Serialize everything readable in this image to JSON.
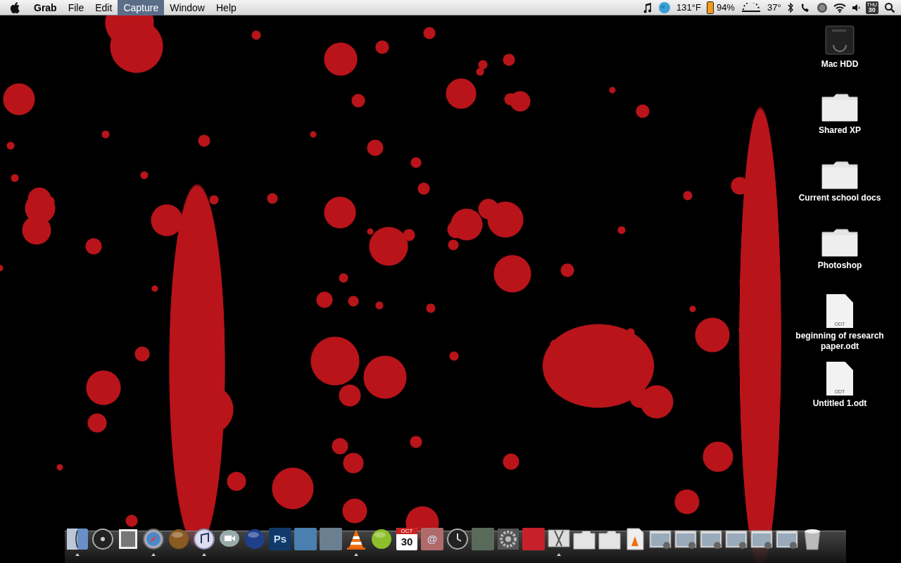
{
  "menu_bar": {
    "app_name": "Grab",
    "menus": [
      {
        "label": "File",
        "selected": false
      },
      {
        "label": "Edit",
        "selected": false
      },
      {
        "label": "Capture",
        "selected": true
      },
      {
        "label": "Window",
        "selected": false
      },
      {
        "label": "Help",
        "selected": false
      }
    ],
    "extras": [
      {
        "kind": "music"
      },
      {
        "kind": "globe"
      },
      {
        "kind": "text",
        "text": "131°F"
      },
      {
        "kind": "battery",
        "level": 0.94,
        "text": "94%"
      },
      {
        "kind": "weather"
      },
      {
        "kind": "text",
        "text": "37°"
      },
      {
        "kind": "bluetooth"
      },
      {
        "kind": "phone"
      },
      {
        "kind": "record"
      },
      {
        "kind": "wifi"
      },
      {
        "kind": "volume"
      },
      {
        "kind": "calendar",
        "day": "THU",
        "date": "30"
      },
      {
        "kind": "search"
      }
    ]
  },
  "desktop_icons": [
    {
      "kind": "drive",
      "label": "Mac HDD"
    },
    {
      "kind": "folder",
      "label": "Shared XP"
    },
    {
      "kind": "folder",
      "label": "Current school docs"
    },
    {
      "kind": "folder",
      "label": "Photoshop"
    },
    {
      "kind": "document",
      "label": "beginning of research paper.odt",
      "badge": "ODT"
    },
    {
      "kind": "document",
      "label": "Untitled 1.odt",
      "badge": "ODT"
    }
  ],
  "dock": [
    {
      "kind": "finder",
      "running": true
    },
    {
      "kind": "dashboard",
      "running": false
    },
    {
      "kind": "stamp",
      "running": false
    },
    {
      "kind": "compass",
      "running": true
    },
    {
      "kind": "orb",
      "color": "#8a5a20",
      "running": false
    },
    {
      "kind": "music",
      "running": true
    },
    {
      "kind": "video",
      "running": false
    },
    {
      "kind": "orb",
      "color": "#1e3f8a",
      "running": false
    },
    {
      "kind": "tile",
      "text": "Ps",
      "color": "#0f3a6a",
      "running": false
    },
    {
      "kind": "tile",
      "color": "#4a7fb0",
      "running": false
    },
    {
      "kind": "tile",
      "color": "#6a7f90",
      "running": false
    },
    {
      "kind": "cone",
      "running": true
    },
    {
      "kind": "orb",
      "color": "#8cbf2a",
      "running": false
    },
    {
      "kind": "calendar",
      "month": "OCT",
      "date": "30",
      "running": false
    },
    {
      "kind": "tile",
      "text": "@",
      "color": "#b06a6a",
      "running": false
    },
    {
      "kind": "clock",
      "running": false
    },
    {
      "kind": "tile",
      "color": "#5a6a5a",
      "running": false
    },
    {
      "kind": "gear",
      "running": false
    },
    {
      "kind": "tile",
      "color": "#c8202a",
      "running": false
    },
    {
      "kind": "scissors",
      "running": true
    },
    {
      "kind": "folder",
      "running": false
    },
    {
      "kind": "folder",
      "running": false
    },
    {
      "kind": "document",
      "running": false
    },
    {
      "kind": "window",
      "running": false
    },
    {
      "kind": "window",
      "running": false
    },
    {
      "kind": "window",
      "running": false
    },
    {
      "kind": "window",
      "running": false
    },
    {
      "kind": "window",
      "running": false
    },
    {
      "kind": "window",
      "running": false
    },
    {
      "kind": "trash",
      "running": false
    }
  ]
}
